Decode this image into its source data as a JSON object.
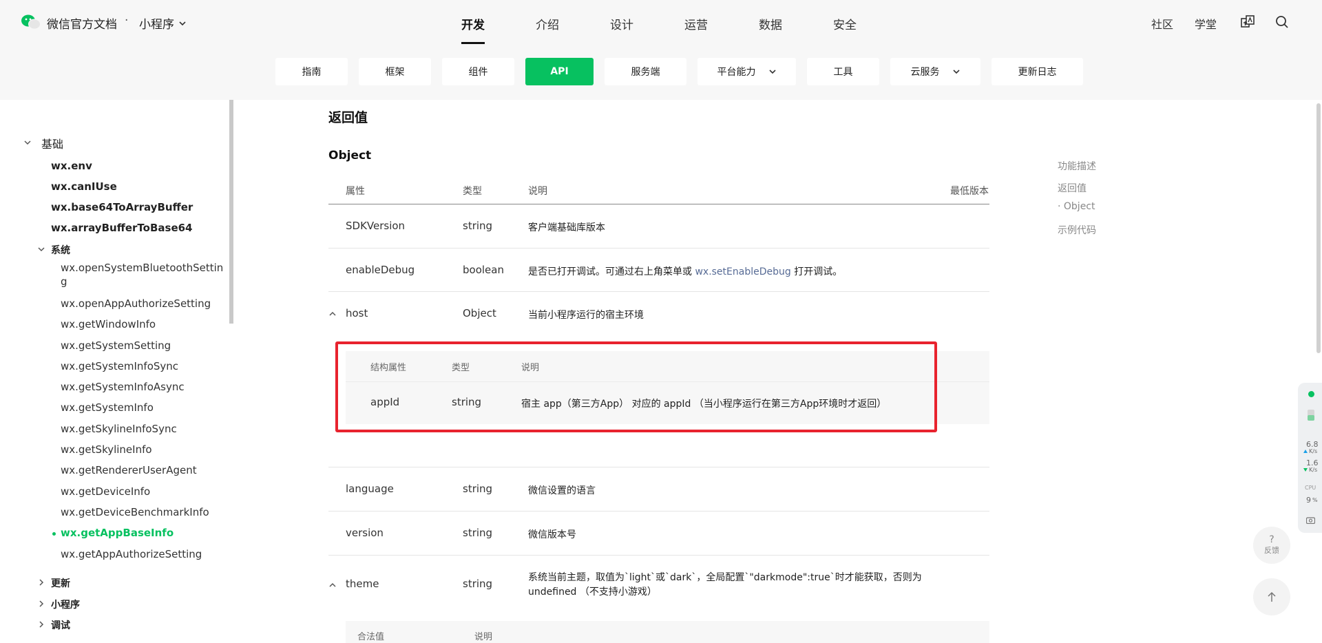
{
  "header": {
    "brand": "微信官方文档",
    "separator": "·",
    "product": "小程序",
    "nav": [
      "开发",
      "介绍",
      "设计",
      "运营",
      "数据",
      "安全"
    ],
    "right_links": [
      "社区",
      "学堂"
    ]
  },
  "subnav": {
    "tabs": [
      "指南",
      "框架",
      "组件",
      "API",
      "服务端",
      "平台能力",
      "工具",
      "云服务",
      "更新日志"
    ]
  },
  "sidebar": {
    "section": "基础",
    "top_items": [
      "wx.env",
      "wx.canIUse",
      "wx.base64ToArrayBuffer",
      "wx.arrayBufferToBase64"
    ],
    "group": "系统",
    "group_items": [
      "wx.openSystemBluetoothSetting",
      "wx.openAppAuthorizeSetting",
      "wx.getWindowInfo",
      "wx.getSystemSetting",
      "wx.getSystemInfoSync",
      "wx.getSystemInfoAsync",
      "wx.getSystemInfo",
      "wx.getSkylineInfoSync",
      "wx.getSkylineInfo",
      "wx.getRendererUserAgent",
      "wx.getDeviceInfo",
      "wx.getDeviceBenchmarkInfo",
      "wx.getAppBaseInfo",
      "wx.getAppAuthorizeSetting"
    ],
    "bluetooth_line1": "wx.openSystemBluetoothSettin",
    "bluetooth_line2": "g",
    "collapsed": [
      "更新",
      "小程序",
      "调试"
    ]
  },
  "content": {
    "returns_title": "返回值",
    "object_title": "Object",
    "headers": {
      "prop": "属性",
      "type": "类型",
      "desc": "说明",
      "min": "最低版本"
    },
    "rows": {
      "sdk": {
        "prop": "SDKVersion",
        "type": "string",
        "desc": "客户端基础库版本"
      },
      "debug": {
        "prop": "enableDebug",
        "type": "boolean",
        "desc_a": "是否已打开调试。可通过右上角菜单或",
        "desc_link": "wx.setEnableDebug",
        "desc_b": "打开调试。"
      },
      "host": {
        "prop": "host",
        "type": "Object",
        "desc": "当前小程序运行的宿主环境"
      },
      "language": {
        "prop": "language",
        "type": "string",
        "desc": "微信设置的语言"
      },
      "version": {
        "prop": "version",
        "type": "string",
        "desc": "微信版本号"
      },
      "theme": {
        "prop": "theme",
        "type": "string",
        "desc_l1": "系统当前主题，取值为`light`或`dark`，全局配置`\"darkmode\":true`时才能获取，否则为",
        "desc_l2": "undefined （不支持小游戏）"
      }
    },
    "host_nested": {
      "headers": {
        "prop": "结构属性",
        "type": "类型",
        "desc": "说明"
      },
      "row": {
        "prop": "appId",
        "type": "string",
        "desc": "宿主 app（第三方App） 对应的 appId （当小程序运行在第三方App环境时才返回）"
      }
    },
    "theme_nested": {
      "headers": {
        "prop": "合法值",
        "desc": "说明"
      }
    }
  },
  "toc": [
    "功能描述",
    "返回值",
    "· Object",
    "示例代码"
  ],
  "perf": {
    "up": "6.8",
    "up_unit": "K/s",
    "down": "1.6",
    "down_unit": "K/s",
    "cpu_label": "CPU",
    "cpu": "9",
    "cpu_unit": "%"
  },
  "feedback": {
    "q": "?",
    "label": "反馈"
  }
}
